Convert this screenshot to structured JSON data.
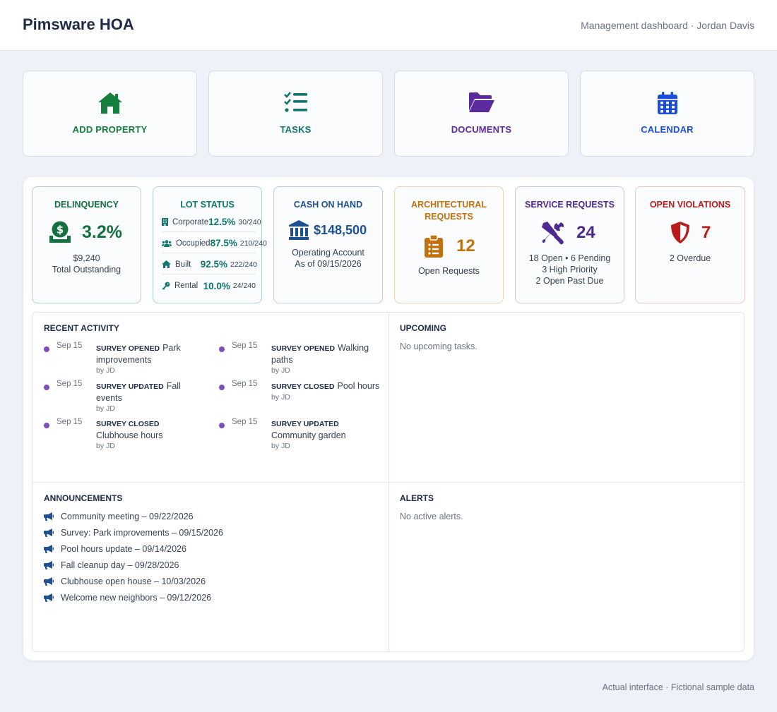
{
  "header": {
    "brand": "Pimsware HOA",
    "user_info": "Management dashboard · Jordan Davis"
  },
  "quick_actions": [
    {
      "label": "ADD PROPERTY",
      "icon": "house-icon",
      "color": "#15803d"
    },
    {
      "label": "TASKS",
      "icon": "task-list-icon",
      "color": "#0f766e"
    },
    {
      "label": "DOCUMENTS",
      "icon": "folder-open-icon",
      "color": "#5b2a9e"
    },
    {
      "label": "CALENDAR",
      "icon": "calendar-icon",
      "color": "#1d4ed8"
    }
  ],
  "stats": {
    "delinquency": {
      "title": "DELINQUENCY",
      "value": "3.2%",
      "amount": "$9,240",
      "caption": "Total Outstanding",
      "icon": "money-hand-icon",
      "color": "#15703f"
    },
    "lot_status": {
      "title": "LOT STATUS",
      "color": "#0f766e",
      "rows": [
        {
          "label": "Corporate",
          "pct": "12.5%",
          "frac": "30/240",
          "icon": "building-icon"
        },
        {
          "label": "Occupied",
          "pct": "87.5%",
          "frac": "210/240",
          "icon": "people-icon"
        },
        {
          "label": "Built",
          "pct": "92.5%",
          "frac": "222/240",
          "icon": "home-icon"
        },
        {
          "label": "Rental",
          "pct": "10.0%",
          "frac": "24/240",
          "icon": "key-icon"
        }
      ]
    },
    "cash": {
      "title": "CASH ON HAND",
      "value": "$148,500",
      "line1": "Operating Account",
      "line2": "As of 09/15/2026",
      "icon": "bank-icon",
      "color": "#1e4f91"
    },
    "architectural": {
      "title_line1": "ARCHITECTURAL",
      "title_line2": "REQUESTS",
      "value": "12",
      "caption": "Open Requests",
      "icon": "clipboard-icon",
      "color": "#c2710c"
    },
    "service": {
      "title": "SERVICE REQUESTS",
      "value": "24",
      "line1": "18 Open • 6 Pending",
      "line2": "3 High Priority",
      "line3": "2 Open Past Due",
      "icon": "tools-icon",
      "color": "#4c2a92"
    },
    "violations": {
      "title": "OPEN VIOLATIONS",
      "value": "7",
      "caption": "2 Overdue",
      "icon": "shield-icon",
      "color": "#b91c1c"
    }
  },
  "recent_activity": {
    "title": "RECENT ACTIVITY",
    "items": [
      {
        "date": "Sep 15",
        "kind": "SURVEY OPENED",
        "text": "Park improvements",
        "by": "by JD"
      },
      {
        "date": "Sep 15",
        "kind": "SURVEY OPENED",
        "text": "Walking paths",
        "by": "by JD"
      },
      {
        "date": "Sep 15",
        "kind": "SURVEY UPDATED",
        "text": "Fall events",
        "by": "by JD"
      },
      {
        "date": "Sep 15",
        "kind": "SURVEY CLOSED",
        "text": "Pool hours",
        "by": "by JD"
      },
      {
        "date": "Sep 15",
        "kind": "SURVEY CLOSED",
        "text": "Clubhouse hours",
        "by": "by JD"
      },
      {
        "date": "Sep 15",
        "kind": "SURVEY UPDATED",
        "text": "Community garden",
        "by": "by JD"
      }
    ]
  },
  "upcoming": {
    "title": "UPCOMING",
    "empty": "No upcoming tasks."
  },
  "announcements": {
    "title": "ANNOUNCEMENTS",
    "items": [
      "Community meeting – 09/22/2026",
      "Survey: Park improvements – 09/15/2026",
      "Pool hours update – 09/14/2026",
      "Fall cleanup day – 09/28/2026",
      "Clubhouse open house – 10/03/2026",
      "Welcome new neighbors – 09/12/2026"
    ]
  },
  "alerts": {
    "title": "ALERTS",
    "empty": "No active alerts."
  },
  "footer": "Actual interface · Fictional sample data"
}
